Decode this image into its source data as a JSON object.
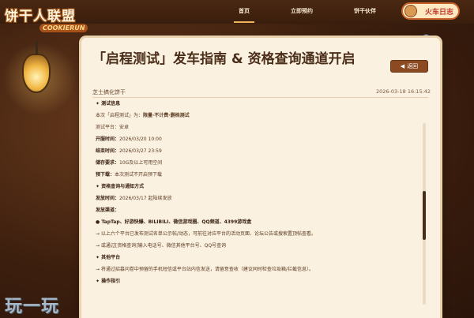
{
  "logo": {
    "title": "饼干人联盟",
    "subtitle": "COOKIERUN"
  },
  "nav": {
    "home": "首页",
    "reserve": "立即预约",
    "partner": "饼干伙伴",
    "badge": "火车日志"
  },
  "article": {
    "title": "「启程测试」发车指南 & 资格查询通道开启",
    "back_label": "返回",
    "author": "芝士搞化饼干",
    "date": "2026-03-18 16:15:42"
  },
  "content": {
    "s1": "✦ 测试信息",
    "line1_pre": "本次「启程测试」为：",
    "line1_val": "限量·不计费·删档测试",
    "platform_label": "测试平台：",
    "platform_val": "安卓",
    "start_label": "开服时间：",
    "start_val": "2026/03/20 10:00",
    "end_label": "结束时间：",
    "end_val": "2026/03/27 23:59",
    "storage_label": "储存要求：",
    "storage_val": "10G及以上可用空间",
    "predownload_label": "预下载：",
    "predownload_val": "本次测试不开启预下载",
    "s2": "✦ 资格查询与通知方式",
    "send_label": "发放时间：",
    "send_val": "2026/03/17 起陆续发放",
    "channel_label": "发放渠道：",
    "channels": "● TapTap、好游快爆、BILIBILI、微信游戏圈、QQ频道、4399游戏盒",
    "arrow1": "→ 以上六个平台已发布测试名单公示帖/动态，可前往对应平台的活动页面、论坛公告或搜索置顶帖查看。",
    "arrow2": "→ 或通过[资格查询]输入电话号、微信其他平台号、QQ号查询",
    "s3": "✦ 其他平台",
    "arrow3": "→ 将通过招募问卷中预留的手机短信或平台站内信发送，请留意查收（建议同时检查垃圾箱/拦截信息）。",
    "s4": "✦ 操作指引"
  },
  "watermark": "玩一玩"
}
